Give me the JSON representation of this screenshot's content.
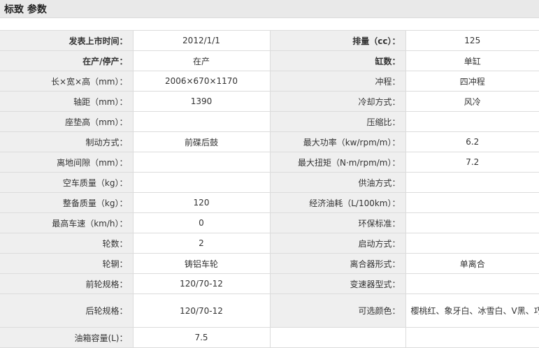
{
  "header": {
    "title": "标致 参数"
  },
  "rows": [
    {
      "l1": "发表上市时间：",
      "v1": "2012/1/1",
      "l2": "排量（cc）：",
      "v2": "125"
    },
    {
      "l1": "在产/停产：",
      "v1": "在产",
      "l2": "缸数：",
      "v2": "单缸"
    },
    {
      "l1": "长×宽×高（mm）：",
      "v1": "2006×670×1170",
      "l2": "冲程：",
      "v2": "四冲程"
    },
    {
      "l1": "轴距（mm）：",
      "v1": "1390",
      "l2": "冷却方式：",
      "v2": "风冷"
    },
    {
      "l1": "座垫高（mm）：",
      "v1": "",
      "l2": "压缩比：",
      "v2": ""
    },
    {
      "l1": "制动方式：",
      "v1": "前碟后鼓",
      "l2": "最大功率（kw/rpm/m）：",
      "v2": "6.2"
    },
    {
      "l1": "离地间隙（mm）：",
      "v1": "",
      "l2": "最大扭矩（N·m/rpm/m）：",
      "v2": "7.2"
    },
    {
      "l1": "空车质量（kg）：",
      "v1": "",
      "l2": "供油方式：",
      "v2": ""
    },
    {
      "l1": "整备质量（kg）：",
      "v1": "120",
      "l2": "经济油耗（L/100km）：",
      "v2": ""
    },
    {
      "l1": "最高车速（km/h）：",
      "v1": "0",
      "l2": "环保标准：",
      "v2": ""
    },
    {
      "l1": "轮数：",
      "v1": "2",
      "l2": "启动方式：",
      "v2": ""
    },
    {
      "l1": "轮辋：",
      "v1": "铸铝车轮",
      "l2": "离合器形式：",
      "v2": "单离合"
    },
    {
      "l1": "前轮规格：",
      "v1": "120/70-12",
      "l2": "变速器型式：",
      "v2": ""
    },
    {
      "l1": "后轮规格：",
      "v1": "120/70-12",
      "l2": "可选颜色：",
      "v2": "樱桃红、象牙白、冰雪白、V黑、巧克力、闪银蓝"
    },
    {
      "l1": "油箱容量(L)：",
      "v1": "7.5",
      "l2": "",
      "v2": ""
    }
  ]
}
